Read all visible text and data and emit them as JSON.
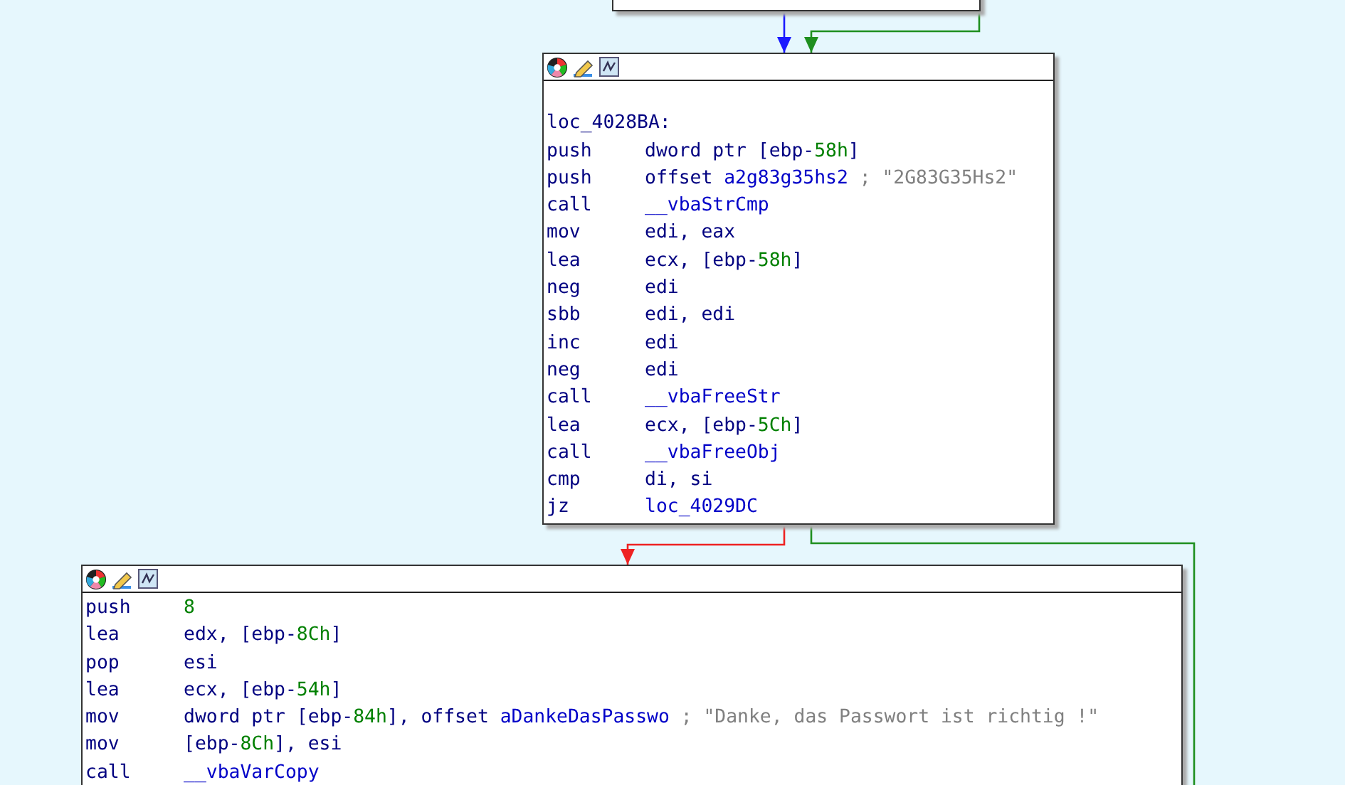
{
  "nodes": [
    {
      "lines": [
        {
          "kind": "blank"
        },
        {
          "kind": "label",
          "text": "loc_4028BA:"
        },
        {
          "kind": "insn",
          "mnemonic": "push",
          "operand": [
            {
              "kind": "text",
              "text": "dword ptr [ebp-"
            },
            {
              "kind": "num",
              "text": "58h"
            },
            {
              "kind": "text",
              "text": "]"
            }
          ]
        },
        {
          "kind": "insn",
          "mnemonic": "push",
          "operand": [
            {
              "kind": "text",
              "text": "offset "
            },
            {
              "kind": "name",
              "text": "a2g83g35hs2"
            }
          ],
          "comment": "; \"2G83G35Hs2\""
        },
        {
          "kind": "insn",
          "mnemonic": "call",
          "operand": [
            {
              "kind": "name",
              "text": "__vbaStrCmp"
            }
          ]
        },
        {
          "kind": "insn",
          "mnemonic": "mov",
          "operand": [
            {
              "kind": "text",
              "text": "edi, eax"
            }
          ]
        },
        {
          "kind": "insn",
          "mnemonic": "lea",
          "operand": [
            {
              "kind": "text",
              "text": "ecx, [ebp-"
            },
            {
              "kind": "num",
              "text": "58h"
            },
            {
              "kind": "text",
              "text": "]"
            }
          ]
        },
        {
          "kind": "insn",
          "mnemonic": "neg",
          "operand": [
            {
              "kind": "text",
              "text": "edi"
            }
          ]
        },
        {
          "kind": "insn",
          "mnemonic": "sbb",
          "operand": [
            {
              "kind": "text",
              "text": "edi, edi"
            }
          ]
        },
        {
          "kind": "insn",
          "mnemonic": "inc",
          "operand": [
            {
              "kind": "text",
              "text": "edi"
            }
          ]
        },
        {
          "kind": "insn",
          "mnemonic": "neg",
          "operand": [
            {
              "kind": "text",
              "text": "edi"
            }
          ]
        },
        {
          "kind": "insn",
          "mnemonic": "call",
          "operand": [
            {
              "kind": "name",
              "text": "__vbaFreeStr"
            }
          ]
        },
        {
          "kind": "insn",
          "mnemonic": "lea",
          "operand": [
            {
              "kind": "text",
              "text": "ecx, [ebp-"
            },
            {
              "kind": "num",
              "text": "5Ch"
            },
            {
              "kind": "text",
              "text": "]"
            }
          ]
        },
        {
          "kind": "insn",
          "mnemonic": "call",
          "operand": [
            {
              "kind": "name",
              "text": "__vbaFreeObj"
            }
          ]
        },
        {
          "kind": "insn",
          "mnemonic": "cmp",
          "operand": [
            {
              "kind": "text",
              "text": "di, si"
            }
          ]
        },
        {
          "kind": "insn",
          "mnemonic": "jz",
          "operand": [
            {
              "kind": "name",
              "text": "loc_4029DC"
            }
          ]
        }
      ]
    },
    {
      "lines": [
        {
          "kind": "insn",
          "mnemonic": "push",
          "operand": [
            {
              "kind": "num",
              "text": "8"
            }
          ]
        },
        {
          "kind": "insn",
          "mnemonic": "lea",
          "operand": [
            {
              "kind": "text",
              "text": "edx, [ebp-"
            },
            {
              "kind": "num",
              "text": "8Ch"
            },
            {
              "kind": "text",
              "text": "]"
            }
          ]
        },
        {
          "kind": "insn",
          "mnemonic": "pop",
          "operand": [
            {
              "kind": "text",
              "text": "esi"
            }
          ]
        },
        {
          "kind": "insn",
          "mnemonic": "lea",
          "operand": [
            {
              "kind": "text",
              "text": "ecx, [ebp-"
            },
            {
              "kind": "num",
              "text": "54h"
            },
            {
              "kind": "text",
              "text": "]"
            }
          ]
        },
        {
          "kind": "insn",
          "mnemonic": "mov",
          "operand": [
            {
              "kind": "text",
              "text": "dword ptr [ebp-"
            },
            {
              "kind": "num",
              "text": "84h"
            },
            {
              "kind": "text",
              "text": "], offset "
            },
            {
              "kind": "name",
              "text": "aDankeDasPasswo"
            }
          ],
          "comment": "; \"Danke, das Passwort ist richtig !\""
        },
        {
          "kind": "insn",
          "mnemonic": "mov",
          "operand": [
            {
              "kind": "text",
              "text": "[ebp-"
            },
            {
              "kind": "num",
              "text": "8Ch"
            },
            {
              "kind": "text",
              "text": "], esi"
            }
          ]
        },
        {
          "kind": "insn",
          "mnemonic": "call",
          "operand": [
            {
              "kind": "name",
              "text": "__vbaVarCopy"
            }
          ]
        }
      ]
    }
  ],
  "edges": [
    {
      "kind": "unconditional"
    },
    {
      "kind": "taken"
    },
    {
      "kind": "not_taken"
    },
    {
      "kind": "taken"
    }
  ]
}
